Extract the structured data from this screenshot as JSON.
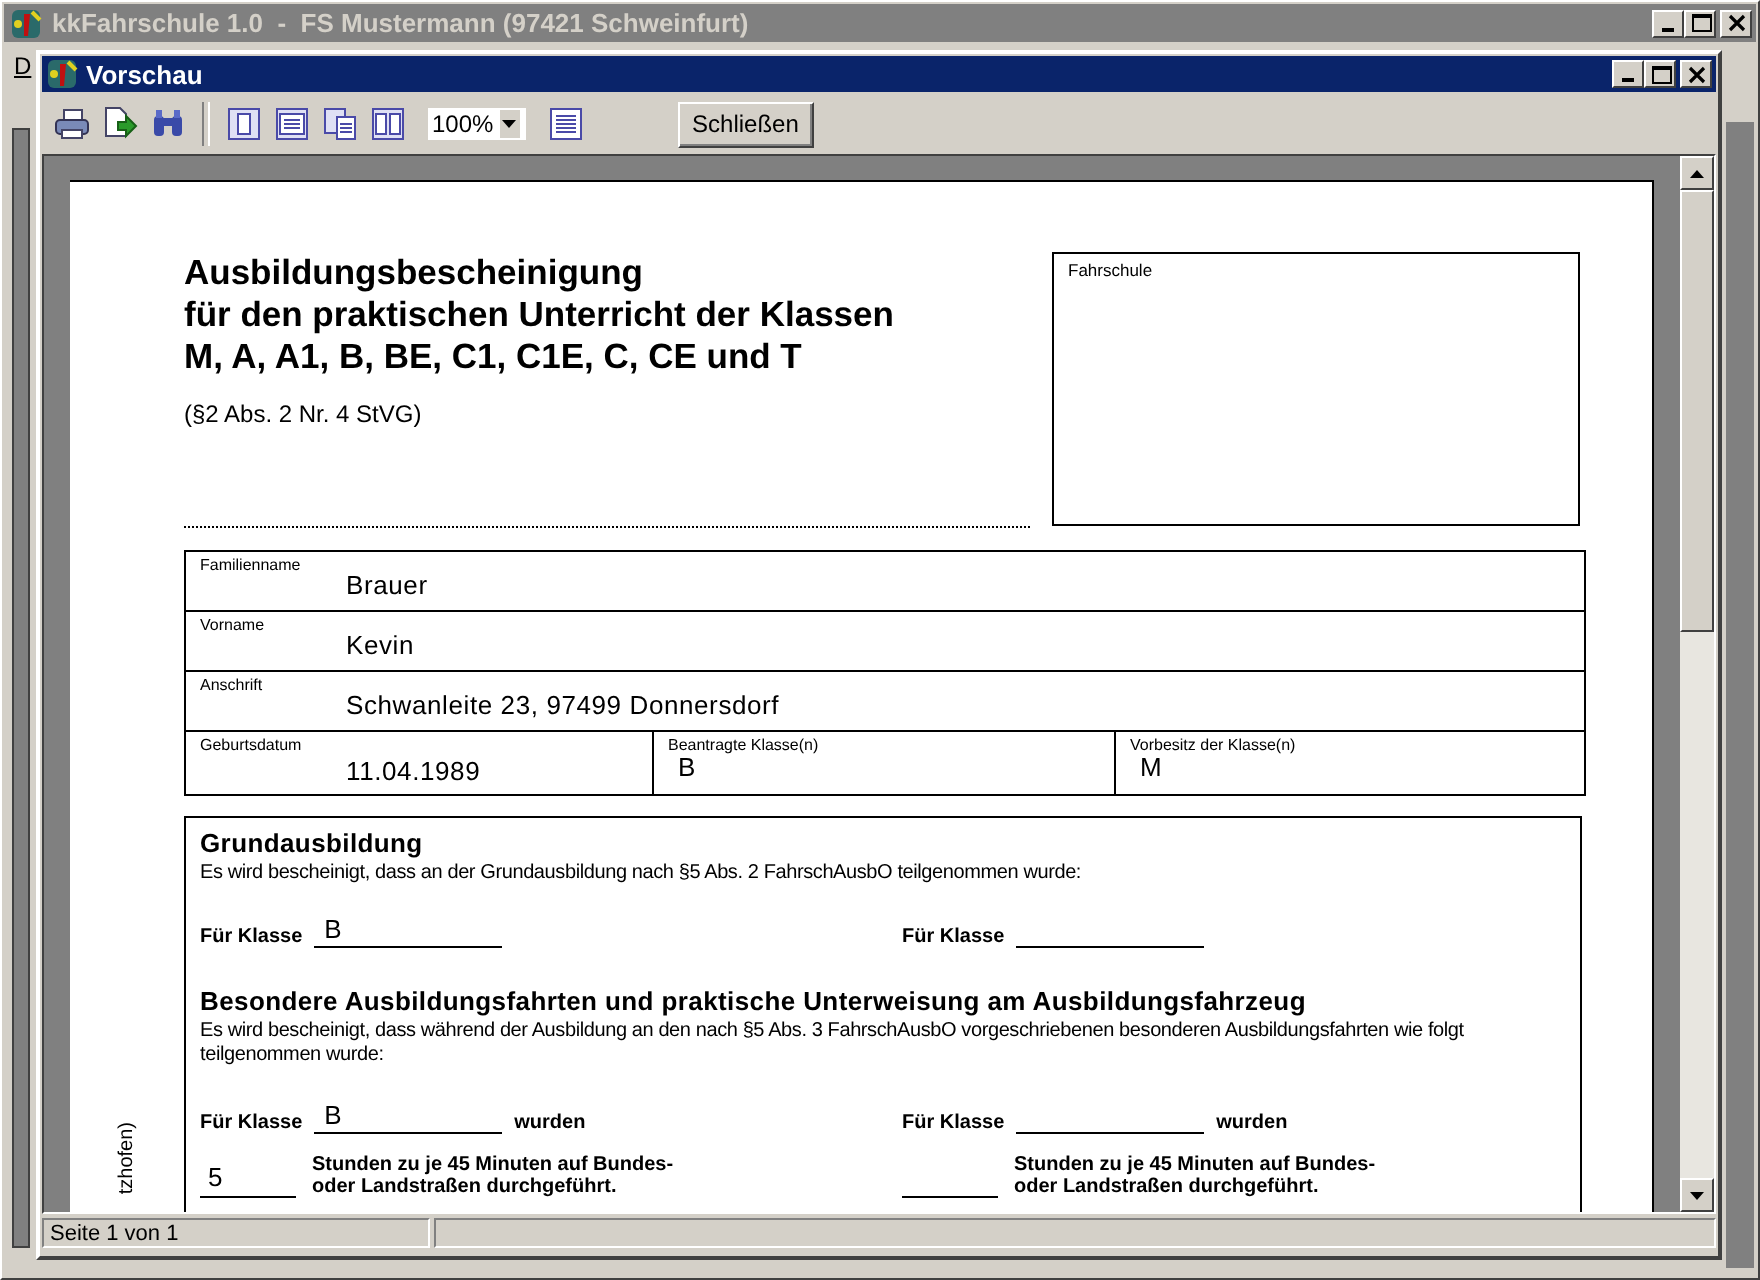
{
  "app_window": {
    "title": "kkFahrschule 1.0  -  FS Mustermann (97421 Schweinfurt)",
    "menu_letter": "D"
  },
  "preview_window": {
    "title": "Vorschau",
    "toolbar": {
      "zoom": "100%",
      "close_button": "Schließen"
    },
    "document": {
      "title_lines": [
        "Ausbildungsbescheinigung",
        "für den praktischen Unterricht der Klassen",
        "M, A, A1, B, BE, C1, C1E, C, CE und T"
      ],
      "legal_reference": "(§2 Abs. 2 Nr. 4 StVG)",
      "school_box_label": "Fahrschule",
      "personal_fields": [
        {
          "label": "Familienname",
          "value": "Brauer"
        },
        {
          "label": "Vorname",
          "value": "Kevin"
        },
        {
          "label": "Anschrift",
          "value": "Schwanleite 23, 97499 Donnersdorf"
        }
      ],
      "birth_row": [
        {
          "label": "Geburtsdatum",
          "value": "11.04.1989"
        },
        {
          "label": "Beantragte Klasse(n)",
          "value": "B"
        },
        {
          "label": "Vorbesitz der Klasse(n)",
          "value": "M"
        }
      ],
      "sections": [
        {
          "heading": "Grundausbildung",
          "text": "Es wird bescheinigt, dass an der Grundausbildung nach §5 Abs. 2 FahrschAusbO  teilgenommen wurde:",
          "class_fields": [
            {
              "label": "Für Klasse",
              "value": "B"
            },
            {
              "label": "Für Klasse"
            }
          ]
        },
        {
          "heading": "Besondere Ausbildungsfahrten und praktische Unterweisung am Ausbildungsfahrzeug",
          "text": "Es wird bescheinigt, dass während der Ausbildung an den nach §5 Abs. 3 FahrschAusbO vorgeschriebenen besonderen Ausbildungsfahrten wie folgt teilgenommen wurde:",
          "class_fields": [
            {
              "label": "Für Klasse",
              "value": "B",
              "suffix": "wurden"
            },
            {
              "label": "Für Klasse",
              "suffix": "wurden"
            }
          ],
          "hours": [
            {
              "value": "5",
              "text": "Stunden zu je 45 Minuten auf Bundes-\noder Landstraßen durchgeführt."
            },
            {
              "text": "Stunden zu je 45 Minuten auf Bundes-\noder Landstraßen durchgeführt."
            }
          ]
        }
      ],
      "margin_note": "tzhofen)"
    },
    "status_bar": {
      "page": "Seite 1 von 1"
    }
  }
}
